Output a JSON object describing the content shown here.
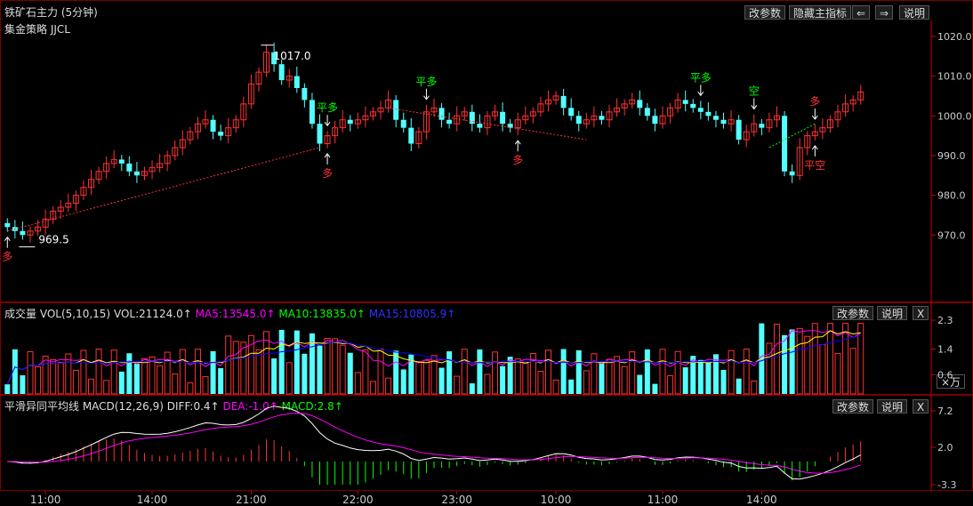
{
  "header": {
    "title": "铁矿石主力 (5分钟)",
    "strategy": "集金策略 JJCL",
    "btn_params": "改参数",
    "btn_hide": "隐藏主指标",
    "btn_prev": "⇐",
    "btn_next": "⇒",
    "btn_help": "说明"
  },
  "vol_panel": {
    "label": "成交量 VOL(5,10,15)",
    "vol": "VOL:21124.0↑",
    "ma5": "MA5:13545.0↑",
    "ma10": "MA10:13835.0↑",
    "ma15": "MA15:10805.9↑",
    "btn_params": "改参数",
    "btn_help": "说明",
    "btn_close": "X",
    "unit": "×万"
  },
  "macd_panel": {
    "label": "平滑异同平均线 MACD(12,26,9)",
    "diff": "DIFF:0.4↑",
    "dea": "DEA:-1.0↑",
    "macd": "MACD:2.8↑",
    "btn_params": "改参数",
    "btn_help": "说明",
    "btn_close": "X"
  },
  "colors": {
    "up": "#ff3232",
    "down": "#54ffff",
    "ma5": "#ff00ff",
    "ma10": "#ffff00",
    "ma15": "#0000ff",
    "diff": "#ffffff",
    "dea": "#ff00ff",
    "signal_green": "#00ff00",
    "axis": "#cc0000"
  },
  "chart_data": [
    {
      "type": "candlestick",
      "ylim": [
        962,
        1022
      ],
      "y_ticks": [
        "1020.0",
        "1010.0",
        "1000.0",
        "990.0",
        "980.0",
        "970.0"
      ],
      "x_ticks": [
        "11:00",
        "14:00",
        "21:00",
        "22:00",
        "23:00",
        "10:00",
        "11:00",
        "14:00"
      ],
      "annotations": {
        "high": "1017.0",
        "low": "969.5"
      },
      "signals": [
        {
          "label": "多",
          "color": "red"
        },
        {
          "label": "平多",
          "color": "green"
        },
        {
          "label": "多",
          "color": "red"
        },
        {
          "label": "平多",
          "color": "green"
        },
        {
          "label": "多",
          "color": "red"
        },
        {
          "label": "平多",
          "color": "green"
        },
        {
          "label": "空",
          "color": "green"
        },
        {
          "label": "平空",
          "color": "red"
        },
        {
          "label": "多",
          "color": "red"
        }
      ],
      "close": [
        972,
        971,
        970,
        971,
        972,
        974,
        976,
        977,
        978,
        980,
        982,
        984,
        986,
        988,
        989,
        988,
        986,
        985,
        986,
        987,
        988,
        990,
        992,
        994,
        996,
        998,
        999,
        996,
        995,
        997,
        999,
        1003,
        1008,
        1011,
        1016,
        1013,
        1009,
        1010,
        1007,
        1004,
        998,
        993,
        995,
        997,
        999,
        998,
        999,
        1000,
        1001,
        1002,
        1004,
        999,
        997,
        993,
        996,
        1001,
        1002,
        999,
        998,
        1000,
        1001,
        998,
        997,
        1000,
        1001,
        998,
        997,
        999,
        1000,
        1001,
        1003,
        1004,
        1005,
        1002,
        1000,
        998,
        999,
        1000,
        999,
        1001,
        1002,
        1003,
        1004,
        1002,
        1000,
        998,
        1000,
        1002,
        1004,
        1003,
        1002,
        1001,
        1000,
        999,
        998,
        999,
        994,
        996,
        998,
        997,
        999,
        1000,
        986,
        985,
        992,
        995,
        996,
        997,
        999,
        1001,
        1003,
        1004,
        1006
      ]
    },
    {
      "type": "bar",
      "name": "VOL",
      "ylim": [
        0,
        2.3
      ],
      "y_ticks": [
        "2.3",
        "1.4",
        "0.6"
      ]
    },
    {
      "type": "bar",
      "name": "MACD",
      "ylim": [
        -3.3,
        7.2
      ],
      "y_ticks": [
        "7.2",
        "2.0",
        "-3.3"
      ]
    }
  ]
}
